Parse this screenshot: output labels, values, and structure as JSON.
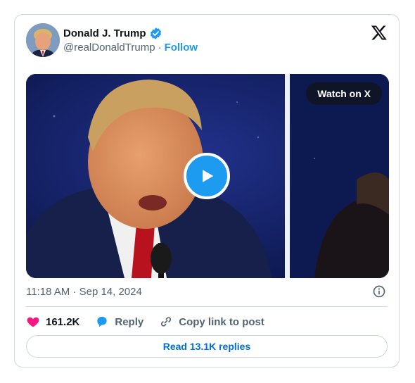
{
  "user": {
    "display_name": "Donald J. Trump",
    "handle": "@realDonaldTrump",
    "separator": "·",
    "follow_label": "Follow",
    "verified": true
  },
  "media": {
    "watch_label": "Watch on X",
    "play_icon": "play-icon"
  },
  "meta": {
    "timestamp": "11:18 AM · Sep 14, 2024"
  },
  "actions": {
    "likes": "161.2K",
    "reply_label": "Reply",
    "copy_label": "Copy link to post"
  },
  "read_replies_label": "Read 13.1K replies",
  "colors": {
    "accent": "#1d9bf0",
    "like": "#f91880",
    "secondary_text": "#536471",
    "border": "#cfd9de"
  }
}
